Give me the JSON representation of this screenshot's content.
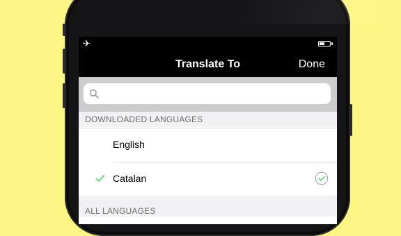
{
  "status_bar": {
    "airplane_icon": "airplane-icon",
    "battery_icon": "battery-icon"
  },
  "nav": {
    "title": "Translate To",
    "done_label": "Done"
  },
  "search": {
    "placeholder": "",
    "icon": "search-icon"
  },
  "sections": {
    "downloaded_header": "DOWNLOADED LANGUAGES",
    "all_header": "ALL LANGUAGES"
  },
  "downloaded_languages": [
    {
      "label": "English",
      "selected": false
    },
    {
      "label": "Catalan",
      "selected": true,
      "download_status_icon": "check-circle-icon"
    }
  ],
  "colors": {
    "background": "#fdf685",
    "accent_check": "#4cd964",
    "navbar": "#000000",
    "section_header_bg": "#f1f1f3"
  }
}
